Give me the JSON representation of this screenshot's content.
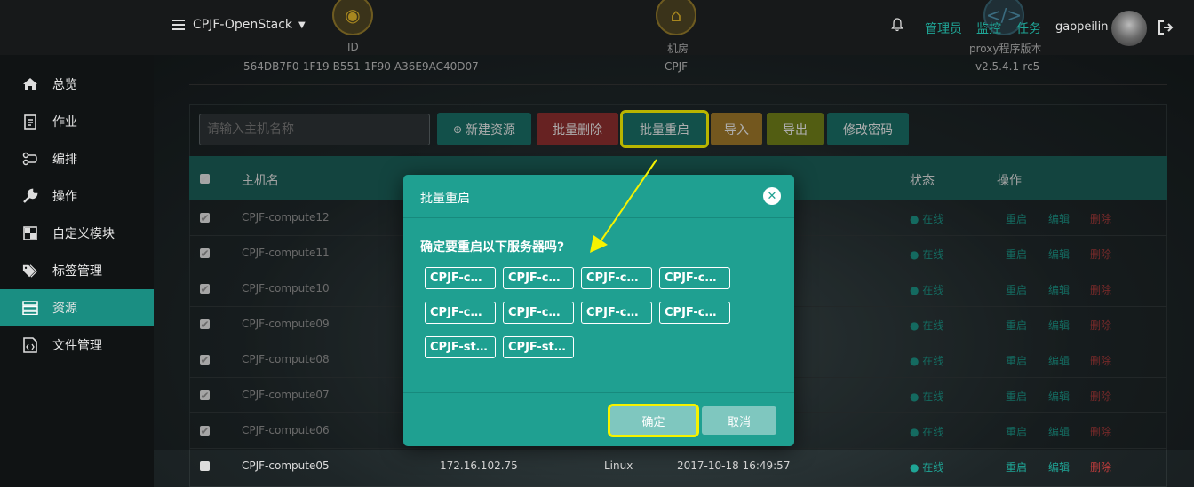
{
  "topbar": {
    "project": "CPJF-OpenStack",
    "info": [
      {
        "label": "ID",
        "icon": "globe-icon"
      },
      {
        "label": "机房",
        "icon": "bank-icon"
      },
      {
        "label": "proxy程序版本",
        "icon": "code-icon"
      }
    ],
    "links": [
      "管理员",
      "监控",
      "任务"
    ],
    "username": "gaopeilin"
  },
  "host": {
    "id": "564DB7F0-1F19-B551-1F90-A36E9AC40D07",
    "room": "CPJF",
    "proxy_version": "v2.5.4.1-rc5"
  },
  "sidebar": {
    "items": [
      {
        "label": "总览",
        "icon": "home-icon"
      },
      {
        "label": "作业",
        "icon": "clipboard-icon"
      },
      {
        "label": "编排",
        "icon": "flow-icon"
      },
      {
        "label": "操作",
        "icon": "wrench-icon"
      },
      {
        "label": "自定义模块",
        "icon": "module-icon"
      },
      {
        "label": "标签管理",
        "icon": "tag-icon"
      },
      {
        "label": "资源",
        "icon": "server-icon"
      },
      {
        "label": "文件管理",
        "icon": "file-code-icon"
      }
    ]
  },
  "toolbar": {
    "search_placeholder": "请输入主机名称",
    "new_resource": "新建资源",
    "batch_delete": "批量删除",
    "batch_restart": "批量重启",
    "import": "导入",
    "export": "导出",
    "change_password": "修改密码"
  },
  "table": {
    "headers": {
      "name": "主机名",
      "status": "状态",
      "ops": "操作"
    },
    "rows": [
      {
        "name": "CPJF-compute12",
        "status": "在线"
      },
      {
        "name": "CPJF-compute11",
        "status": "在线"
      },
      {
        "name": "CPJF-compute10",
        "status": "在线"
      },
      {
        "name": "CPJF-compute09",
        "status": "在线"
      },
      {
        "name": "CPJF-compute08",
        "status": "在线"
      },
      {
        "name": "CPJF-compute07",
        "status": "在线"
      },
      {
        "name": "CPJF-compute06",
        "status": "在线"
      },
      {
        "name": "CPJF-compute05",
        "ip": "172.16.102.75",
        "os": "Linux",
        "time": "2017-10-18 16:49:57",
        "status": "在线"
      }
    ],
    "ops": {
      "restart": "重启",
      "edit": "编辑",
      "delete": "删除"
    }
  },
  "modal": {
    "title": "批量重启",
    "question": "确定要重启以下服务器吗?",
    "servers": [
      "CPJF-c…",
      "CPJF-c…",
      "CPJF-c…",
      "CPJF-c…",
      "CPJF-c…",
      "CPJF-c…",
      "CPJF-c…",
      "CPJF-c…",
      "CPJF-st…",
      "CPJF-st…"
    ],
    "confirm": "确定",
    "cancel": "取消"
  },
  "colors": {
    "accent": "#1fa091",
    "highlight": "#f6f200",
    "danger": "#a13838"
  }
}
